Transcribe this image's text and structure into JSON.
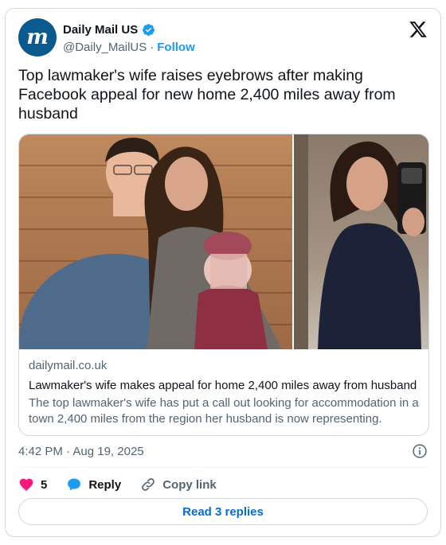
{
  "author": {
    "display_name": "Daily Mail US",
    "handle": "@Daily_MailUS",
    "follow_label": "Follow",
    "verified": true,
    "avatar_icon": "daily-mail-logo",
    "avatar_glyph": "m"
  },
  "tweet": {
    "text": "Top lawmaker's wife raises eyebrows after making Facebook appeal for new home 2,400 miles away from husband"
  },
  "link_card": {
    "domain": "dailymail.co.uk",
    "title": "Lawmaker's wife makes appeal for home 2,400 miles away from husband",
    "description": "The top lawmaker's wife has put a call out looking for accommodation in a town 2,400 miles from the region her husband is now representing."
  },
  "meta": {
    "time": "4:42 PM",
    "separator": "·",
    "date": "Aug 19, 2025"
  },
  "actions": {
    "like_count": "5",
    "reply_label": "Reply",
    "copy_link_label": "Copy link"
  },
  "replies_button": {
    "label": "Read 3 replies"
  },
  "colors": {
    "accent": "#1d9bf0",
    "link_blue": "#006fd6",
    "like_pink": "#f91880",
    "brand_navy": "#0b5a8d"
  }
}
